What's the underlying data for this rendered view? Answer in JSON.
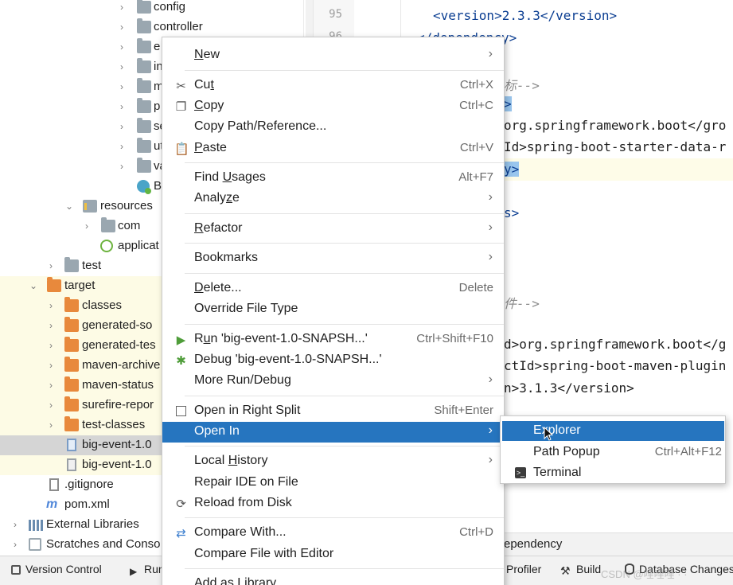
{
  "tree": {
    "rows": [
      {
        "arrow": "›",
        "icon": "folder",
        "label": "config"
      },
      {
        "arrow": "›",
        "icon": "folder",
        "label": "controller"
      },
      {
        "arrow": "›",
        "icon": "folder",
        "label": "e"
      },
      {
        "arrow": "›",
        "icon": "folder",
        "label": "in"
      },
      {
        "arrow": "›",
        "icon": "folder",
        "label": "m"
      },
      {
        "arrow": "›",
        "icon": "folder",
        "label": "p"
      },
      {
        "arrow": "›",
        "icon": "folder",
        "label": "se"
      },
      {
        "arrow": "›",
        "icon": "folder",
        "label": "ut"
      },
      {
        "arrow": "›",
        "icon": "folder",
        "label": "va"
      },
      {
        "arrow": "",
        "icon": "class",
        "label": "B"
      },
      {
        "arrow": "⌄",
        "icon": "resources-folder",
        "label": "resources"
      },
      {
        "arrow": "›",
        "icon": "folder",
        "label": "com"
      },
      {
        "arrow": "",
        "icon": "spring-config",
        "label": "applicat"
      },
      {
        "arrow": "›",
        "icon": "folder",
        "label": "test"
      },
      {
        "arrow": "⌄",
        "icon": "folder-orange",
        "label": "target"
      },
      {
        "arrow": "›",
        "icon": "folder-orange",
        "label": "classes"
      },
      {
        "arrow": "›",
        "icon": "folder-orange",
        "label": "generated-so"
      },
      {
        "arrow": "›",
        "icon": "folder-orange",
        "label": "generated-tes"
      },
      {
        "arrow": "›",
        "icon": "folder-orange",
        "label": "maven-archive"
      },
      {
        "arrow": "›",
        "icon": "folder-orange",
        "label": "maven-status"
      },
      {
        "arrow": "›",
        "icon": "folder-orange",
        "label": "surefire-repor"
      },
      {
        "arrow": "›",
        "icon": "folder-orange",
        "label": "test-classes"
      },
      {
        "arrow": "",
        "icon": "jar-file",
        "label": "big-event-1.0"
      },
      {
        "arrow": "",
        "icon": "unknown-file",
        "label": "big-event-1.0"
      },
      {
        "arrow": "",
        "icon": "gitignore-file",
        "label": ".gitignore"
      },
      {
        "arrow": "",
        "icon": "maven-file",
        "label": "pom.xml"
      },
      {
        "arrow": "›",
        "icon": "library",
        "label": "External Libraries"
      },
      {
        "arrow": "›",
        "icon": "scratches",
        "label": "Scratches and Conso"
      }
    ]
  },
  "editor": {
    "line_numbers": [
      "95",
      "96"
    ],
    "lines": [
      {
        "kind": "tag",
        "text": "<version>2.3.3</version>"
      },
      {
        "kind": "tag",
        "text": "</dependency>"
      },
      {
        "kind": "comment",
        "text": "标-->"
      },
      {
        "kind": "sel",
        "text": ">"
      },
      {
        "kind": "mixed",
        "text": "org.springframework.boot</gro"
      },
      {
        "kind": "mixed",
        "text": "Id>spring-boot-starter-data-r"
      },
      {
        "kind": "sel",
        "text": "y>"
      },
      {
        "kind": "tag",
        "text": "s>"
      },
      {
        "kind": "comment",
        "text": "件-->"
      },
      {
        "kind": "mixed",
        "text": "d>org.springframework.boot</g"
      },
      {
        "kind": "mixed",
        "text": "ctId>spring-boot-maven-plugin"
      },
      {
        "kind": "mixed",
        "text": "n>3.1.3</version>"
      }
    ],
    "breadcrumb": "ependency"
  },
  "context_menu": {
    "items": [
      {
        "label": "New",
        "mnemonic": "N",
        "shortcut": "",
        "submenu": true,
        "icon": ""
      },
      {
        "label": "Cut",
        "mnemonic": "t",
        "shortcut": "Ctrl+X",
        "submenu": false,
        "icon": "scissors-icon"
      },
      {
        "label": "Copy",
        "mnemonic": "C",
        "shortcut": "Ctrl+C",
        "submenu": false,
        "icon": "copy-icon"
      },
      {
        "label": "Copy Path/Reference...",
        "mnemonic": "",
        "shortcut": "",
        "submenu": false,
        "icon": ""
      },
      {
        "label": "Paste",
        "mnemonic": "P",
        "shortcut": "Ctrl+V",
        "submenu": false,
        "icon": "paste-icon"
      },
      {
        "label": "Find Usages",
        "mnemonic": "U",
        "shortcut": "Alt+F7",
        "submenu": false,
        "icon": ""
      },
      {
        "label": "Analyze",
        "mnemonic": "z",
        "shortcut": "",
        "submenu": true,
        "icon": ""
      },
      {
        "label": "Refactor",
        "mnemonic": "R",
        "shortcut": "",
        "submenu": true,
        "icon": ""
      },
      {
        "label": "Bookmarks",
        "mnemonic": "",
        "shortcut": "",
        "submenu": true,
        "icon": ""
      },
      {
        "label": "Delete...",
        "mnemonic": "D",
        "shortcut": "Delete",
        "submenu": false,
        "icon": ""
      },
      {
        "label": "Override File Type",
        "mnemonic": "",
        "shortcut": "",
        "submenu": false,
        "icon": ""
      },
      {
        "label": "Run 'big-event-1.0-SNAPSH...'",
        "mnemonic": "u",
        "shortcut": "Ctrl+Shift+F10",
        "submenu": false,
        "icon": "run-icon"
      },
      {
        "label": "Debug 'big-event-1.0-SNAPSH...'",
        "mnemonic": "",
        "shortcut": "",
        "submenu": false,
        "icon": "debug-icon"
      },
      {
        "label": "More Run/Debug",
        "mnemonic": "",
        "shortcut": "",
        "submenu": true,
        "icon": ""
      },
      {
        "label": "Open in Right Split",
        "mnemonic": "",
        "shortcut": "Shift+Enter",
        "submenu": false,
        "icon": "split-icon"
      },
      {
        "label": "Open In",
        "mnemonic": "",
        "shortcut": "",
        "submenu": true,
        "icon": ""
      },
      {
        "label": "Local History",
        "mnemonic": "H",
        "shortcut": "",
        "submenu": true,
        "icon": ""
      },
      {
        "label": "Repair IDE on File",
        "mnemonic": "",
        "shortcut": "",
        "submenu": false,
        "icon": ""
      },
      {
        "label": "Reload from Disk",
        "mnemonic": "",
        "shortcut": "",
        "submenu": false,
        "icon": "reload-icon"
      },
      {
        "label": "Compare With...",
        "mnemonic": "",
        "shortcut": "Ctrl+D",
        "submenu": false,
        "icon": "compare-icon"
      },
      {
        "label": "Compare File with Editor",
        "mnemonic": "",
        "shortcut": "",
        "submenu": false,
        "icon": ""
      },
      {
        "label": "Add as Library...",
        "mnemonic": "",
        "shortcut": "",
        "submenu": false,
        "icon": ""
      }
    ]
  },
  "open_in_submenu": {
    "items": [
      {
        "label": "Explorer",
        "shortcut": ""
      },
      {
        "label": "Path Popup",
        "shortcut": "Ctrl+Alt+F12"
      },
      {
        "label": "Terminal",
        "shortcut": ""
      }
    ]
  },
  "statusbar": {
    "version_control": "Version Control",
    "run": "Run",
    "profiler": "Profiler",
    "build": "Build",
    "database_changes": "Database Changes"
  },
  "watermark": "CSDN @哩哩哩 · ·"
}
